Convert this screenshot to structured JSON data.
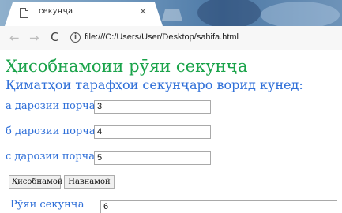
{
  "browser": {
    "tab_title": "секунҷа",
    "close_glyph": "×",
    "address_url": "file:///C:/Users/User/Desktop/sahifa.html"
  },
  "page": {
    "title": "Ҳисобнамоии рӯяи секунҷа",
    "subtitle": "Қиматҳои тарафҳои секунҷаро ворид кунед:",
    "fields": [
      {
        "label": "а дарозии порча",
        "value": "3"
      },
      {
        "label": "б дарозии порча",
        "value": "4"
      },
      {
        "label": "с дарозии порча",
        "value": "5"
      }
    ],
    "buttons": {
      "calculate": "Ҳисобнамоӣ",
      "reset": "Навнамоӣ"
    },
    "result": {
      "label": "Рӯяи секунҷа",
      "value": "6"
    }
  },
  "icons": {
    "back": "back-arrow-icon",
    "forward": "forward-arrow-icon",
    "reload": "reload-icon",
    "info": "info-icon",
    "page": "page-icon"
  }
}
